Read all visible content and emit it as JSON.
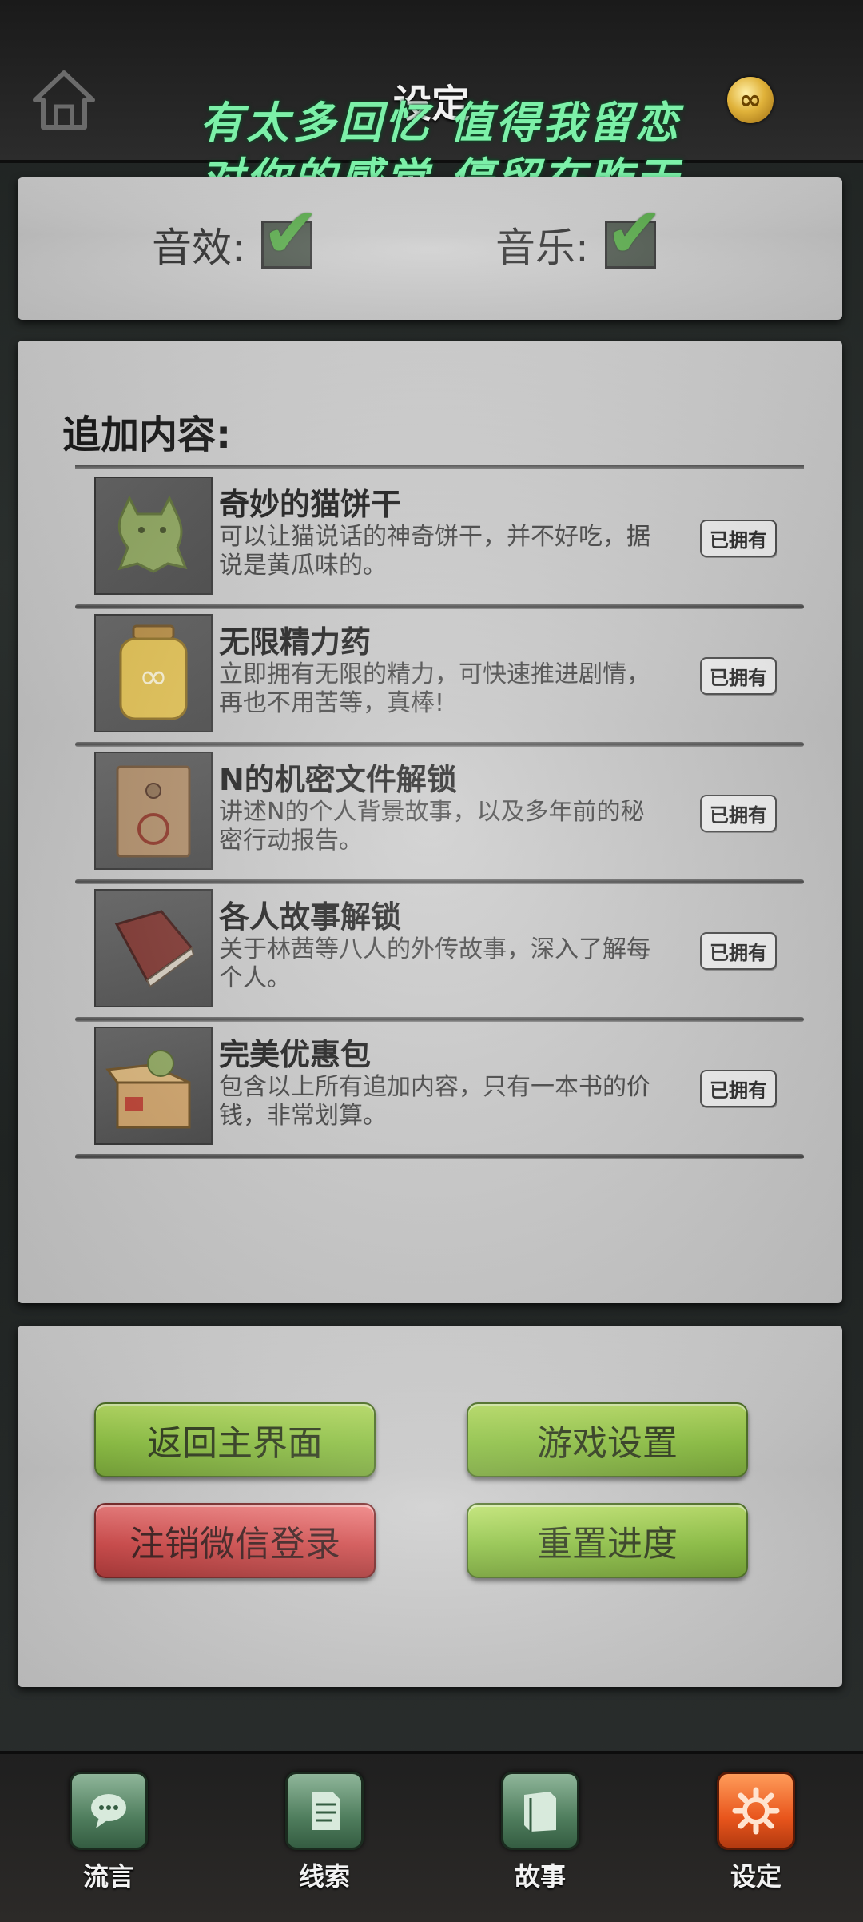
{
  "header": {
    "title": "设定",
    "lyrics": [
      "有太多回忆 值得我留恋",
      "对你的感觉 停留在昨天"
    ]
  },
  "sound_settings": {
    "sfx_label": "音效:",
    "music_label": "音乐:"
  },
  "content": {
    "section_title": "追加内容:",
    "owned_label": "已拥有",
    "items": [
      {
        "name": "奇妙的猫饼干",
        "desc": "可以让猫说话的神奇饼干，并不好吃，据说是黄瓜味的。"
      },
      {
        "name": "无限精力药",
        "desc": "立即拥有无限的精力，可快速推进剧情，再也不用苦等，真棒!"
      },
      {
        "name": "N的机密文件解锁",
        "desc": "讲述N的个人背景故事，以及多年前的秘密行动报告。"
      },
      {
        "name": "各人故事解锁",
        "desc": "关于林茜等八人的外传故事，深入了解每个人。"
      },
      {
        "name": "完美优惠包",
        "desc": "包含以上所有追加内容，只有一本书的价钱，非常划算。"
      }
    ]
  },
  "buttons": {
    "back_main": "返回主界面",
    "game_settings": "游戏设置",
    "logout_wechat": "注销微信登录",
    "reset_progress": "重置进度"
  },
  "nav": {
    "items": [
      {
        "label": "流言"
      },
      {
        "label": "线索"
      },
      {
        "label": "故事"
      },
      {
        "label": "设定"
      }
    ]
  },
  "colors": {
    "accent_green": "#86c033",
    "accent_red": "#d03b3b",
    "lyrics_green": "#7cf0a8",
    "active_nav": "#e8551c"
  }
}
